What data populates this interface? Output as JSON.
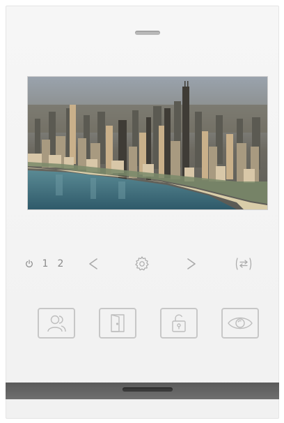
{
  "device": {
    "screen_content": "city-skyline-photo",
    "colors": {
      "body": "#f3f3f3",
      "icons": "#a9a9a9",
      "buttons_outline": "#c7c7c7",
      "bottom_bar": "#636363"
    }
  },
  "controls": {
    "power_icon": "power-icon",
    "channel_1": "1",
    "channel_2": "2",
    "prev_icon": "chevron-left-icon",
    "settings_icon": "gear-icon",
    "next_icon": "chevron-right-icon",
    "transfer_icon": "transfer-arrows-icon"
  },
  "buttons": [
    {
      "icon": "contacts-icon"
    },
    {
      "icon": "door-icon"
    },
    {
      "icon": "unlock-icon"
    },
    {
      "icon": "monitor-eye-icon"
    }
  ]
}
